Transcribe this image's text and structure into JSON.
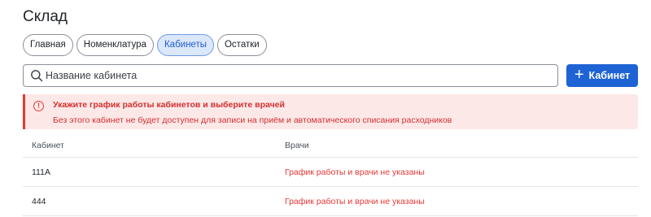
{
  "page": {
    "title": "Склад"
  },
  "tabs": [
    {
      "label": "Главная",
      "active": false
    },
    {
      "label": "Номенклатура",
      "active": false
    },
    {
      "label": "Кабинеты",
      "active": true
    },
    {
      "label": "Остатки",
      "active": false
    }
  ],
  "search": {
    "placeholder": "Название кабинета",
    "icon": "search-icon"
  },
  "add_button": {
    "label": "Кабинет",
    "icon": "plus-icon"
  },
  "alert": {
    "icon": "alert-circle-icon",
    "title": "Укажите график работы кабинетов и выберите врачей",
    "text": "Без этого кабинет не будет доступен для записи на приём и автоматического списания расходников"
  },
  "table": {
    "headers": [
      "Кабинет",
      "Врачи"
    ],
    "rows": [
      {
        "cabinet": "111А",
        "doctors": "График работы и врачи не указаны"
      },
      {
        "cabinet": "444",
        "doctors": "График работы и врачи не указаны"
      }
    ]
  },
  "colors": {
    "accent": "#1e63d4",
    "error": "#e53935",
    "alert_bg": "#fde8e8",
    "active_tab_bg": "#dbe7fb"
  }
}
